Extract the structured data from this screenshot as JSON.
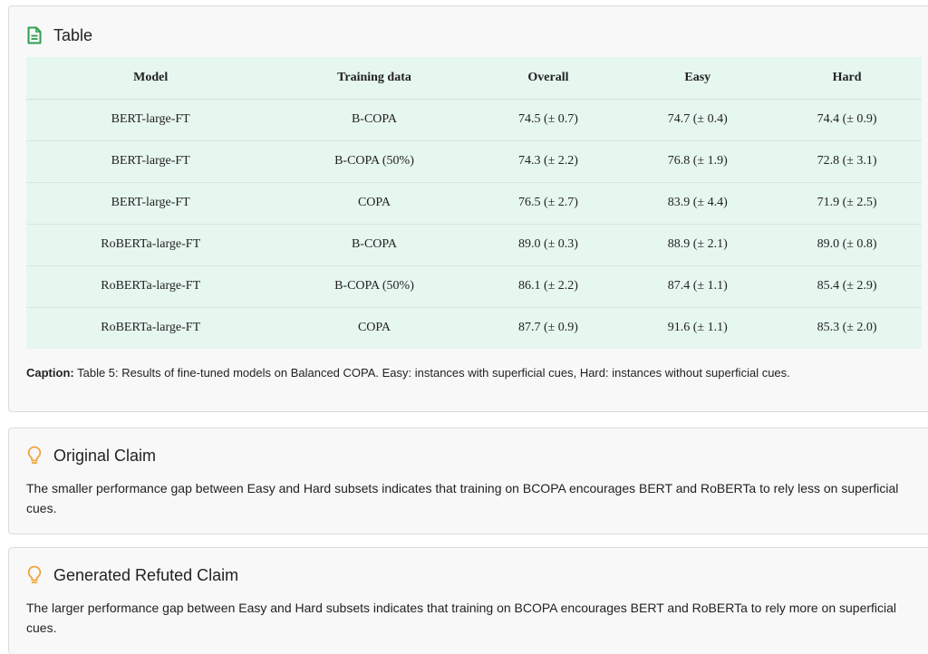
{
  "table_section": {
    "title": "Table",
    "columns": [
      "Model",
      "Training data",
      "Overall",
      "Easy",
      "Hard"
    ],
    "rows": [
      [
        "BERT-large-FT",
        "B-COPA",
        "74.5 (± 0.7)",
        "74.7 (± 0.4)",
        "74.4 (± 0.9)"
      ],
      [
        "BERT-large-FT",
        "B-COPA (50%)",
        "74.3 (± 2.2)",
        "76.8 (± 1.9)",
        "72.8 (± 3.1)"
      ],
      [
        "BERT-large-FT",
        "COPA",
        "76.5 (± 2.7)",
        "83.9 (± 4.4)",
        "71.9 (± 2.5)"
      ],
      [
        "RoBERTa-large-FT",
        "B-COPA",
        "89.0 (± 0.3)",
        "88.9 (± 2.1)",
        "89.0 (± 0.8)"
      ],
      [
        "RoBERTa-large-FT",
        "B-COPA (50%)",
        "86.1 (± 2.2)",
        "87.4 (± 1.1)",
        "85.4 (± 2.9)"
      ],
      [
        "RoBERTa-large-FT",
        "COPA",
        "87.7 (± 0.9)",
        "91.6 (± 1.1)",
        "85.3 (± 2.0)"
      ]
    ],
    "caption_label": "Caption:",
    "caption_text": "Table 5: Results of fine-tuned models on Balanced COPA. Easy: instances with superficial cues, Hard: instances without superficial cues."
  },
  "original_claim": {
    "title": "Original Claim",
    "text": "The smaller performance gap between Easy and Hard subsets indicates that training on BCOPA encourages BERT and RoBERTa to rely less on superficial cues."
  },
  "refuted_claim": {
    "title": "Generated Refuted Claim",
    "text": "The larger performance gap between Easy and Hard subsets indicates that training on BCOPA encourages BERT and RoBERTa to rely more on superficial cues."
  },
  "icons": {
    "table": "document-icon",
    "claim": "lightbulb-icon"
  },
  "colors": {
    "table_icon": "#2e9e4f",
    "bulb_icon": "#f0a23a",
    "table_bg": "#e6f7ef"
  }
}
